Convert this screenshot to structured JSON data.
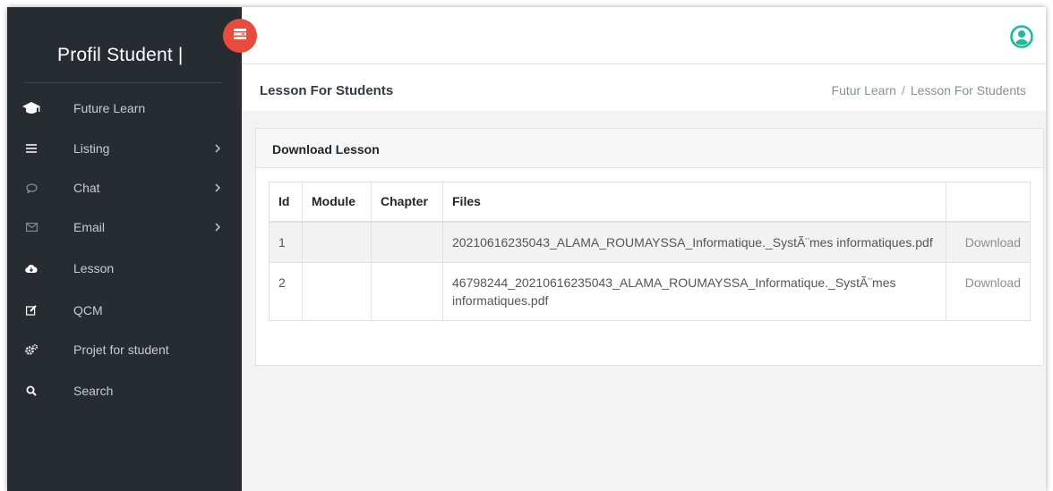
{
  "sidebar": {
    "brand": "Profil Student |",
    "items": [
      {
        "label": "Future Learn",
        "icon": "graduation-cap-icon",
        "has_arrow": false
      },
      {
        "label": "Listing",
        "icon": "table-icon",
        "has_arrow": true
      },
      {
        "label": "Chat",
        "icon": "chat-bubble-icon",
        "has_arrow": true
      },
      {
        "label": "Email",
        "icon": "envelope-icon",
        "has_arrow": true
      },
      {
        "label": "Lesson",
        "icon": "cloud-download-icon",
        "has_arrow": false
      },
      {
        "label": "QCM",
        "icon": "edit-icon",
        "has_arrow": false
      },
      {
        "label": "Projet for student",
        "icon": "cogs-icon",
        "has_arrow": false
      },
      {
        "label": "Search",
        "icon": "search-icon",
        "has_arrow": false
      }
    ]
  },
  "header": {
    "page_title": "Lesson For Students",
    "breadcrumb": [
      "Futur Learn",
      "Lesson For Students"
    ],
    "breadcrumb_sep": "/"
  },
  "card": {
    "title": "Download Lesson",
    "columns": [
      "Id",
      "Module",
      "Chapter",
      "Files",
      ""
    ],
    "rows": [
      {
        "id": "1",
        "module": "",
        "chapter": "",
        "file": "20210616235043_ALAMA_ROUMAYSSA_Informatique._SystÃ¨mes informatiques.pdf",
        "action": "Download"
      },
      {
        "id": "2",
        "module": "",
        "chapter": "",
        "file": "46798244_20210616235043_ALAMA_ROUMAYSSA_Informatique._SystÃ¨mes informatiques.pdf",
        "action": "Download"
      }
    ]
  },
  "colors": {
    "sidebar_bg": "#272c33",
    "toggle_accent": "#e74c3c",
    "user_icon": "#1abc9c"
  }
}
